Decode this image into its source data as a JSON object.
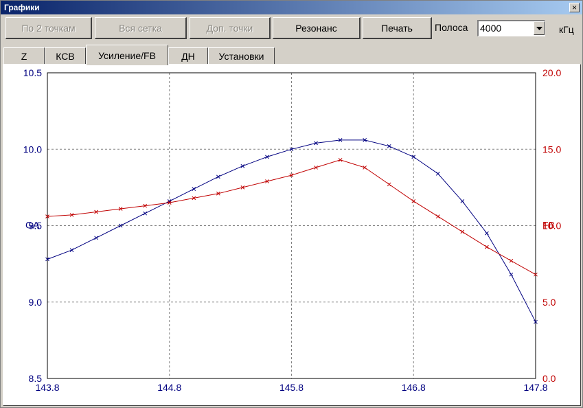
{
  "window": {
    "title": "Графики",
    "close_label": "×"
  },
  "toolbar": {
    "buttons": [
      {
        "label": "По 2 точкам",
        "enabled": false
      },
      {
        "label": "Вся сетка",
        "enabled": false
      },
      {
        "label": "Доп. точки",
        "enabled": false
      },
      {
        "label": "Резонанс",
        "enabled": true
      },
      {
        "label": "Печать",
        "enabled": true
      }
    ],
    "band_label": "Полоса",
    "band_value": "4000",
    "band_unit": "кГц"
  },
  "tabs": [
    {
      "label": "Z",
      "active": false
    },
    {
      "label": "КСВ",
      "active": false
    },
    {
      "label": "Усиление/FB",
      "active": true
    },
    {
      "label": "ДН",
      "active": false
    },
    {
      "label": "Установки",
      "active": false
    }
  ],
  "chart_data": {
    "type": "line",
    "xlim": [
      143.8,
      147.8
    ],
    "x_ticks": [
      "143.8",
      "144.8",
      "145.8",
      "146.8",
      "147.8"
    ],
    "y_left": {
      "label": "GA",
      "lim": [
        8.5,
        10.5
      ],
      "ticks": [
        "8.5",
        "9.0",
        "9.5",
        "10.0",
        "10.5"
      ],
      "color": "#000080"
    },
    "y_right": {
      "label": "FB",
      "lim": [
        0,
        20
      ],
      "ticks": [
        "0.0",
        "5.0",
        "10.0",
        "15.0",
        "20.0"
      ],
      "color": "#c00000"
    },
    "grid": true,
    "x": [
      143.8,
      144.0,
      144.2,
      144.4,
      144.6,
      144.8,
      145.0,
      145.2,
      145.4,
      145.6,
      145.8,
      146.0,
      146.2,
      146.4,
      146.6,
      146.8,
      147.0,
      147.2,
      147.4,
      147.6,
      147.8
    ],
    "series": [
      {
        "name": "GA",
        "axis": "left",
        "color": "#000080",
        "values": [
          9.28,
          9.34,
          9.42,
          9.5,
          9.58,
          9.66,
          9.74,
          9.82,
          9.89,
          9.95,
          10.0,
          10.04,
          10.06,
          10.06,
          10.02,
          9.95,
          9.84,
          9.66,
          9.45,
          9.18,
          8.87
        ]
      },
      {
        "name": "FB",
        "axis": "right",
        "color": "#c00000",
        "values": [
          10.6,
          10.7,
          10.9,
          11.1,
          11.3,
          11.5,
          11.8,
          12.1,
          12.5,
          12.9,
          13.3,
          13.8,
          14.3,
          13.8,
          12.7,
          11.6,
          10.6,
          9.6,
          8.6,
          7.7,
          6.8
        ]
      }
    ]
  }
}
